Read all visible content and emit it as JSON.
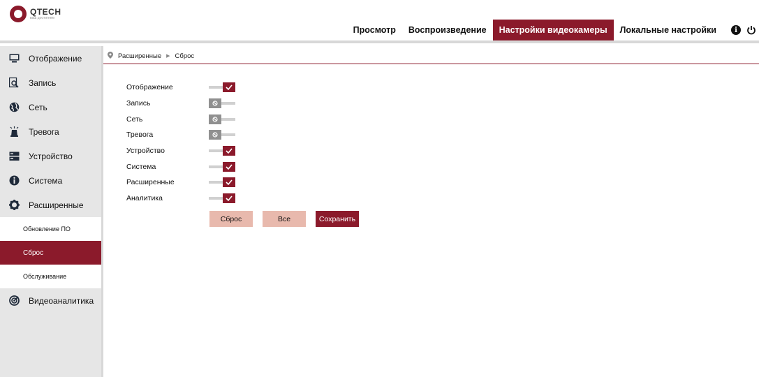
{
  "header": {
    "logo_name": "QTECH",
    "logo_sub": "ваш достигнем",
    "nav": [
      {
        "label": "Просмотр",
        "active": false
      },
      {
        "label": "Воспроизведение",
        "active": false
      },
      {
        "label": "Настройки видеокамеры",
        "active": true
      },
      {
        "label": "Локальные настройки",
        "active": false
      }
    ],
    "icons": [
      "info-icon",
      "power-icon"
    ]
  },
  "sidebar": {
    "items": [
      {
        "label": "Отображение",
        "icon": "monitor-icon"
      },
      {
        "label": "Запись",
        "icon": "record-search-icon"
      },
      {
        "label": "Сеть",
        "icon": "globe-icon"
      },
      {
        "label": "Тревога",
        "icon": "alarm-icon"
      },
      {
        "label": "Устройство",
        "icon": "storage-icon"
      },
      {
        "label": "Система",
        "icon": "info-icon"
      },
      {
        "label": "Расширенные",
        "icon": "gear-icon"
      }
    ],
    "subitems": [
      {
        "label": "Обновление ПО",
        "active": false
      },
      {
        "label": "Сброс",
        "active": true
      },
      {
        "label": "Обслуживание",
        "active": false
      }
    ],
    "last_item": {
      "label": "Видеоаналитика",
      "icon": "analytics-icon"
    }
  },
  "breadcrumb": {
    "parent": "Расширенные",
    "current": "Сброс"
  },
  "options": [
    {
      "label": "Отображение",
      "enabled": true
    },
    {
      "label": "Запись",
      "enabled": false
    },
    {
      "label": "Сеть",
      "enabled": false
    },
    {
      "label": "Тревога",
      "enabled": false
    },
    {
      "label": "Устройство",
      "enabled": true
    },
    {
      "label": "Система",
      "enabled": true
    },
    {
      "label": "Расширенные",
      "enabled": true
    },
    {
      "label": "Аналитика",
      "enabled": true
    }
  ],
  "buttons": {
    "reset": "Сброс",
    "all": "Все",
    "save": "Сохранить"
  },
  "colors": {
    "accent": "#8b1a2b",
    "light_button": "#e8b9ad",
    "sidebar_bg": "#e6e6e6"
  }
}
